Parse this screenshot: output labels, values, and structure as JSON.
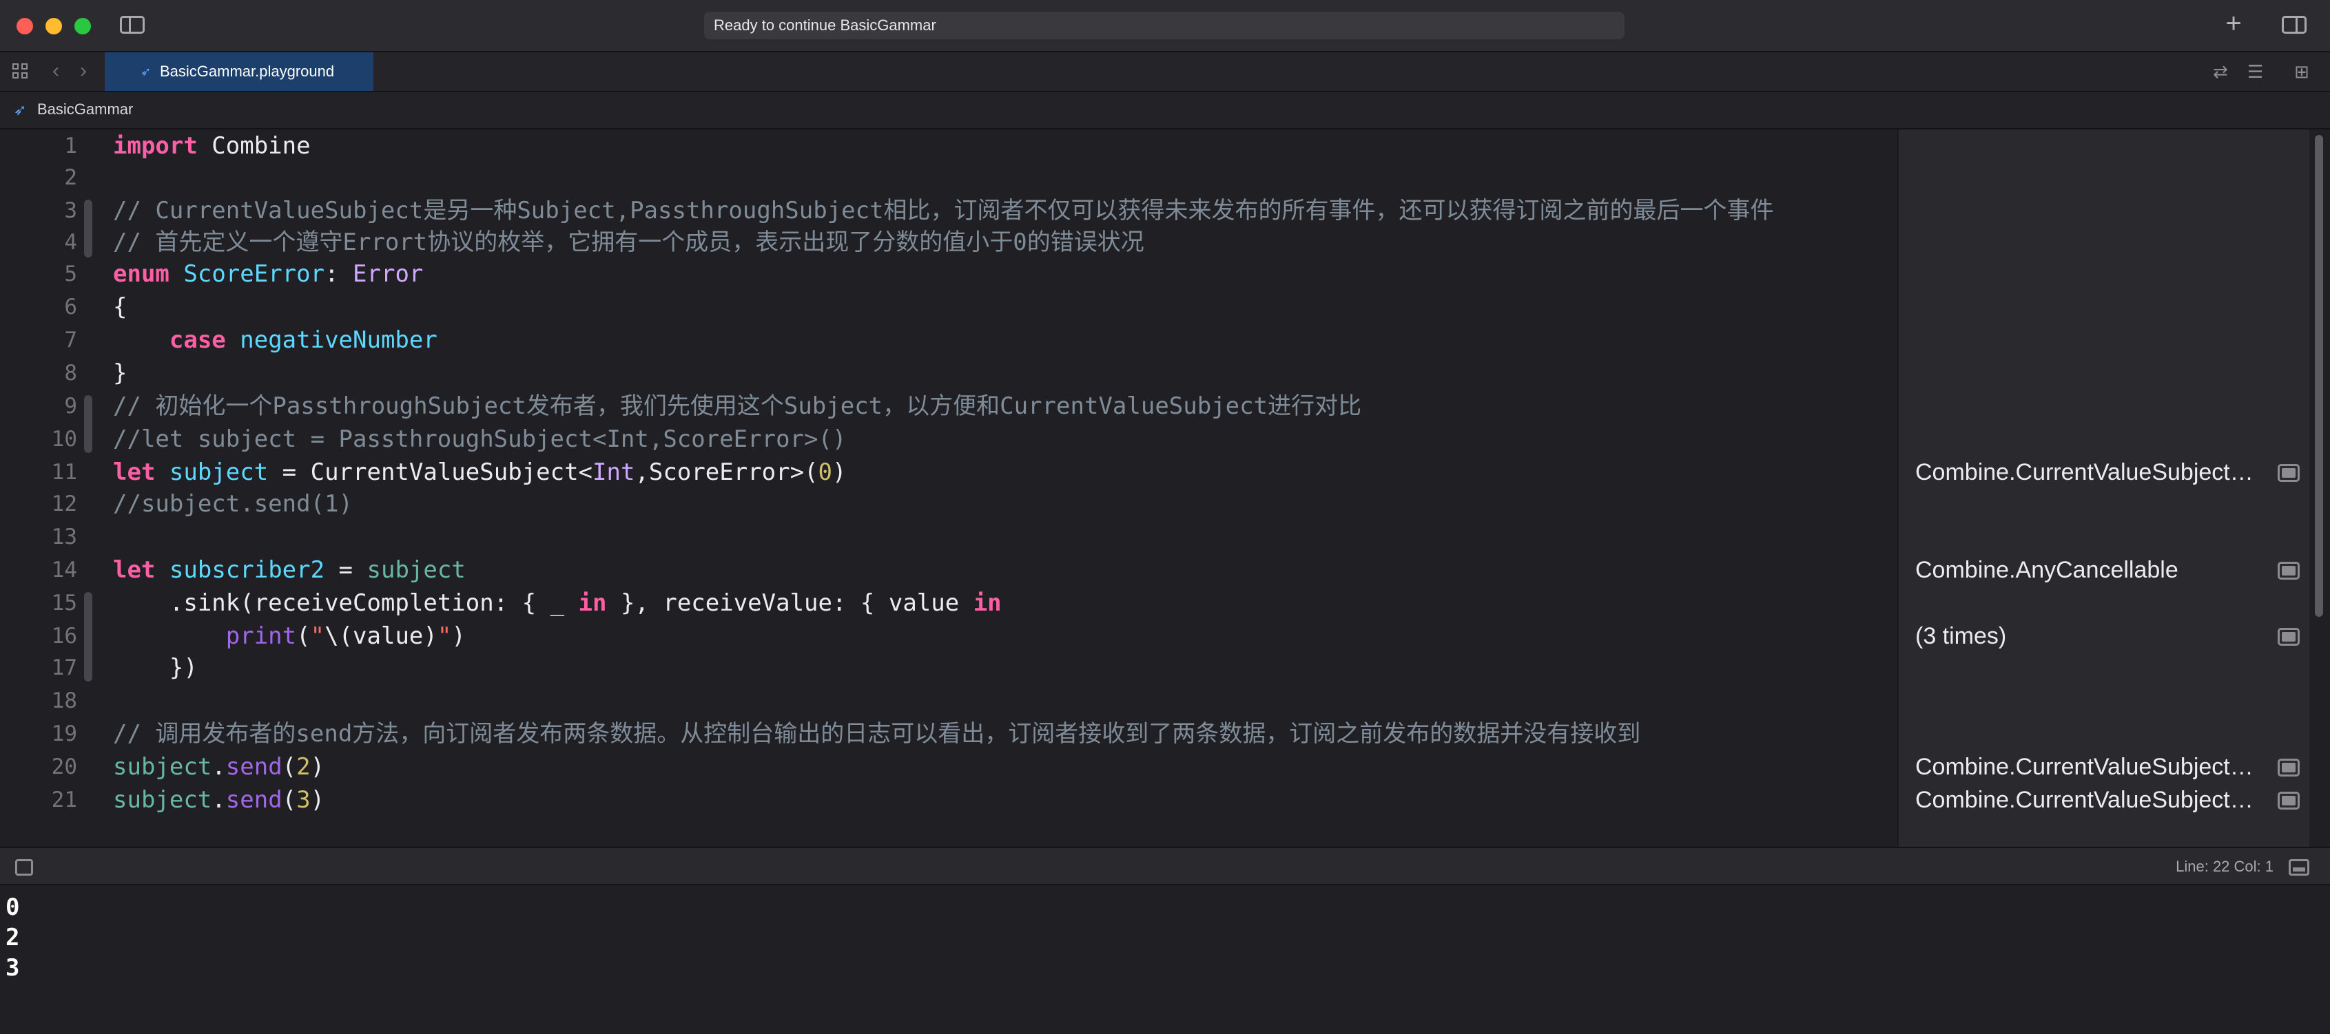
{
  "titlebar": {
    "activity_status": "Ready to continue BasicGammar"
  },
  "tab": {
    "active_file": "BasicGammar.playground"
  },
  "breadcrumb": {
    "item": "BasicGammar"
  },
  "editor": {
    "line_numbers": [
      "1",
      "2",
      "3",
      "4",
      "5",
      "6",
      "7",
      "8",
      "9",
      "10",
      "11",
      "12",
      "13",
      "14",
      "15",
      "16",
      "17",
      "18",
      "19",
      "20",
      "21"
    ],
    "code": {
      "l1_kw": "import",
      "l1_rest": " Combine",
      "l3": "// CurrentValueSubject是另一种Subject,PassthroughSubject相比，订阅者不仅可以获得未来发布的所有事件，还可以获得订阅之前的最后一个事件",
      "l4": "// 首先定义一个遵守Errort协议的枚举，它拥有一个成员，表示出现了分数的值小于0的错误状况",
      "l5_kw": "enum",
      "l5_name": "ScoreError",
      "l5_colon": ": ",
      "l5_type": "Error",
      "l6": "{",
      "l7_kw": "case",
      "l7_name": "negativeNumber",
      "l8": "}",
      "l9": "// 初始化一个PassthroughSubject发布者，我们先使用这个Subject，以方便和CurrentValueSubject进行对比",
      "l10": "//let subject = PassthroughSubject<Int,ScoreError>()",
      "l11_kw": "let",
      "l11_name": "subject",
      "l11_eq": " = CurrentValueSubject<",
      "l11_type": "Int",
      "l11_rest": ",ScoreError>(",
      "l11_num": "0",
      "l11_close": ")",
      "l12": "//subject.send(1)",
      "l14_kw": "let",
      "l14_name": "subscriber2",
      "l14_eq": " = ",
      "l14_val": "subject",
      "l15_a": ".sink(receiveCompletion: { _ ",
      "l15_in1": "in",
      "l15_b": " }, receiveValue: { value ",
      "l15_in2": "in",
      "l16_fn": "print",
      "l16_open": "(",
      "l16_str1": "\"",
      "l16_interp": "\\(value)",
      "l16_str2": "\"",
      "l16_close": ")",
      "l17": "})",
      "l19": "// 调用发布者的send方法，向订阅者发布两条数据。从控制台输出的日志可以看出，订阅者接收到了两条数据，订阅之前发布的数据并没有接收到",
      "l20_obj": "subject",
      "l20_dot": ".",
      "l20_fn": "send",
      "l20_open": "(",
      "l20_num": "2",
      "l20_close": ")",
      "l21_obj": "subject",
      "l21_dot": ".",
      "l21_fn": "send",
      "l21_open": "(",
      "l21_num": "3",
      "l21_close": ")"
    }
  },
  "results": {
    "r11": "Combine.CurrentValueSubject<Int, ScoreError>",
    "r14": "Combine.AnyCancellable",
    "r16": "(3 times)",
    "r20": "Combine.CurrentValueSubject<Int, ScoreError>",
    "r21": "Combine.CurrentValueSubject<Int, ScoreError>"
  },
  "statusbar": {
    "position": "Line: 22  Col: 1"
  },
  "console": {
    "lines": [
      "0",
      "2",
      "3"
    ]
  },
  "icons": {
    "close": "close-icon",
    "minimize": "minimize-icon",
    "zoom": "zoom-icon",
    "sidebar": "sidebar-toggle-icon",
    "add": "plus-icon",
    "inspector": "inspector-toggle-icon",
    "grid": "grid-icon",
    "back": "chevron-left-icon",
    "forward": "chevron-right-icon",
    "swift": "swift-icon",
    "quicklook": "quick-look-icon"
  },
  "colors": {
    "keyword": "#fc5fa3",
    "comment": "#7f8c98",
    "type": "#5dd8ff",
    "number": "#d0bf69",
    "string": "#fc6a5d",
    "tab_active": "#1d3f6b",
    "background": "#1f1f24"
  }
}
